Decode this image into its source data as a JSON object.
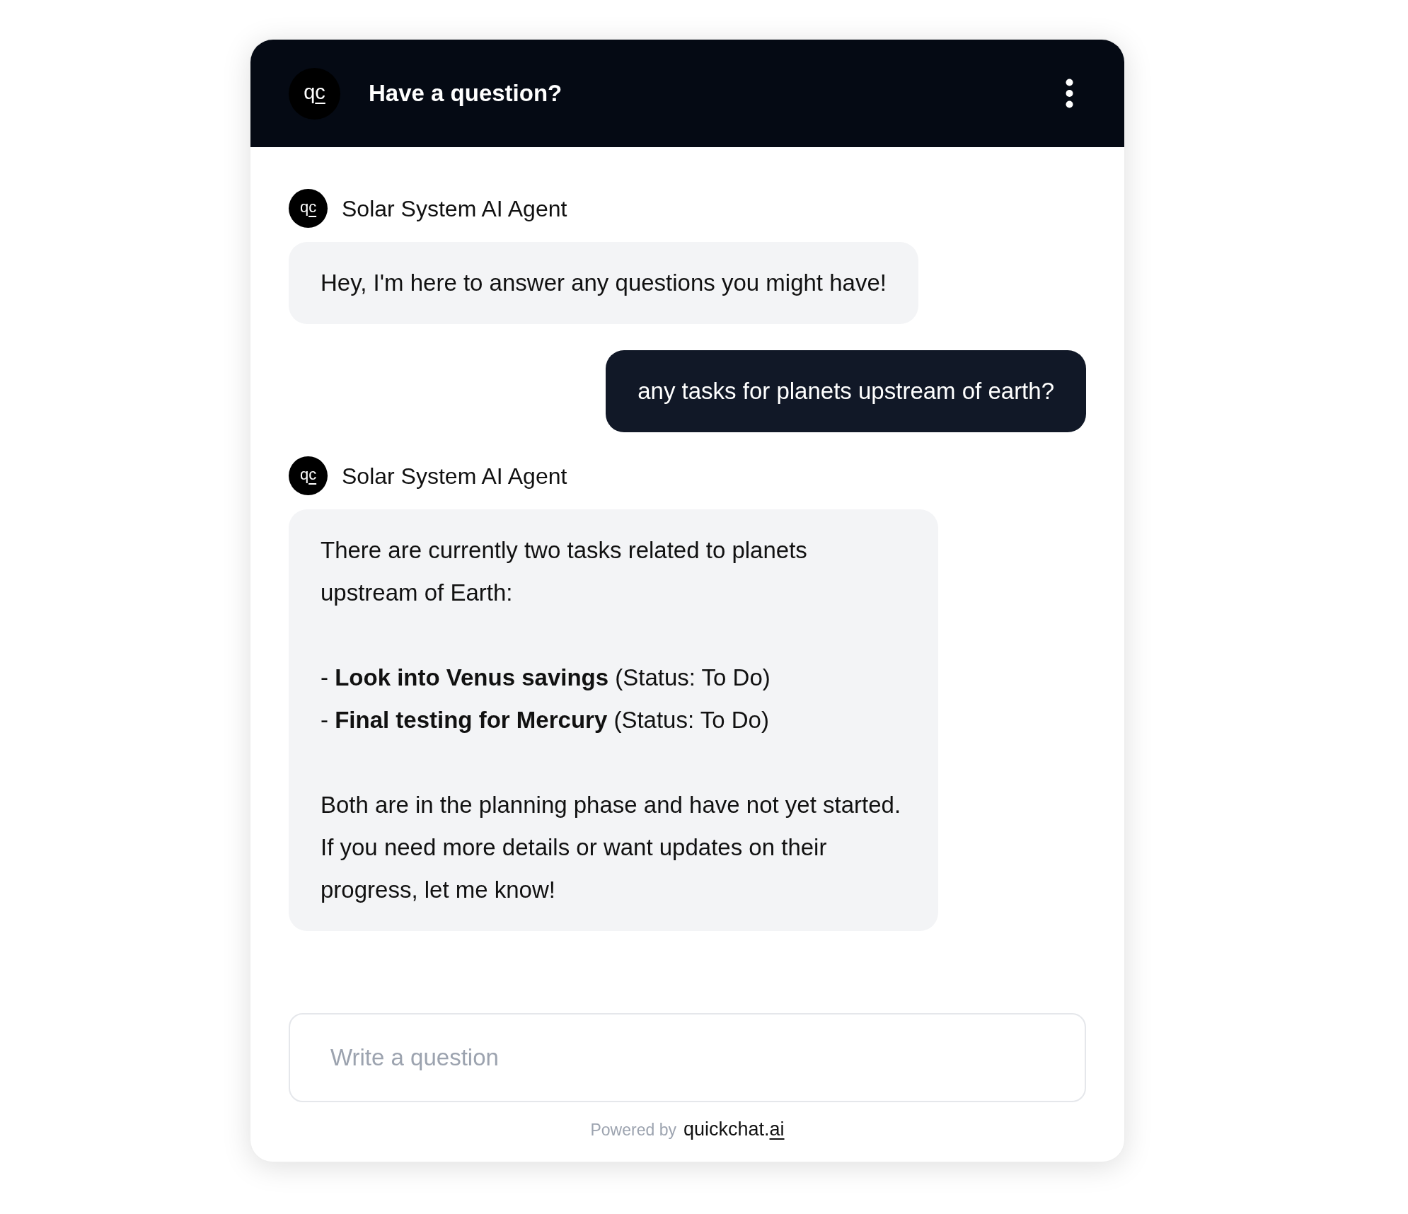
{
  "header": {
    "logo": {
      "text": "q",
      "underlined": "c"
    },
    "title": "Have a question?"
  },
  "messages": [
    {
      "kind": "agent",
      "avatar": {
        "text": "q",
        "underlined": "c"
      },
      "sender": "Solar System AI Agent",
      "body": [
        {
          "kind": "paragraph",
          "text": "Hey, I'm here to answer any questions you might have!"
        }
      ]
    },
    {
      "kind": "user",
      "text": "any tasks for planets upstream of earth?"
    },
    {
      "kind": "agent",
      "avatar": {
        "text": "q",
        "underlined": "c"
      },
      "sender": "Solar System AI Agent",
      "body": [
        {
          "kind": "paragraph",
          "text": "There are currently two tasks related to planets upstream of Earth:"
        },
        {
          "kind": "list",
          "items": [
            "- **Look into Venus savings** (Status: To Do)",
            "- **Final testing for Mercury** (Status: To Do)"
          ]
        },
        {
          "kind": "paragraph",
          "text": "Both are in the planning phase and have not yet started. If you need more details or want updates on their progress, let me know!"
        }
      ]
    }
  ],
  "composer": {
    "placeholder": "Write a question"
  },
  "footer": {
    "label": "Powered by",
    "brand": "quickchat.",
    "brand_underlined": "ai"
  }
}
